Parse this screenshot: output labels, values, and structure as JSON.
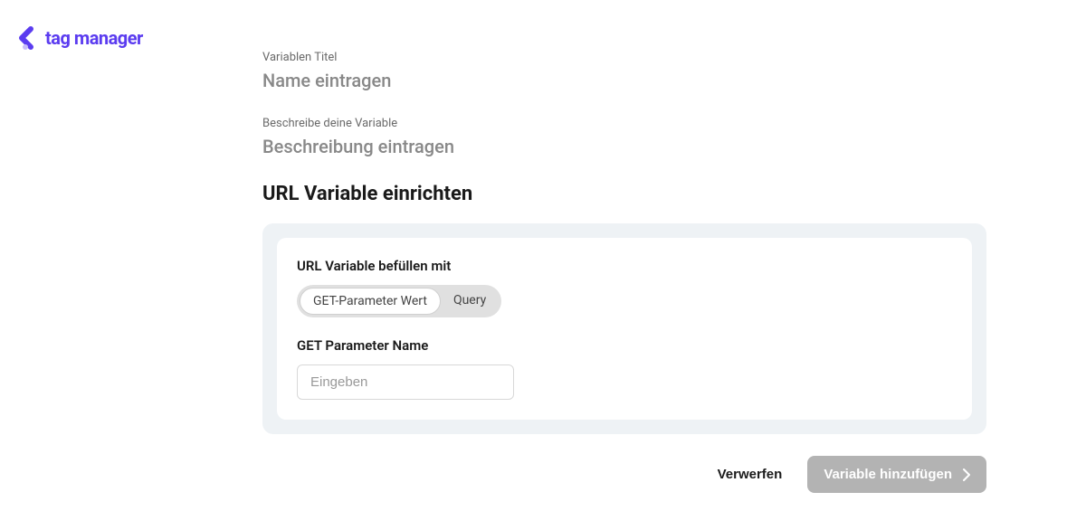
{
  "logo": {
    "text": "tag manager"
  },
  "fields": {
    "title_label": "Variablen Titel",
    "title_placeholder": "Name eintragen",
    "description_label": "Beschreibe deine Variable",
    "description_placeholder": "Beschreibung eintragen"
  },
  "section": {
    "heading": "URL Variable einrichten",
    "fill_label": "URL Variable befüllen mit",
    "pills": {
      "get_param": "GET-Parameter Wert",
      "query": "Query"
    },
    "param_name_label": "GET Parameter Name",
    "param_name_placeholder": "Eingeben"
  },
  "actions": {
    "discard": "Verwerfen",
    "submit": "Variable hinzufügen"
  }
}
